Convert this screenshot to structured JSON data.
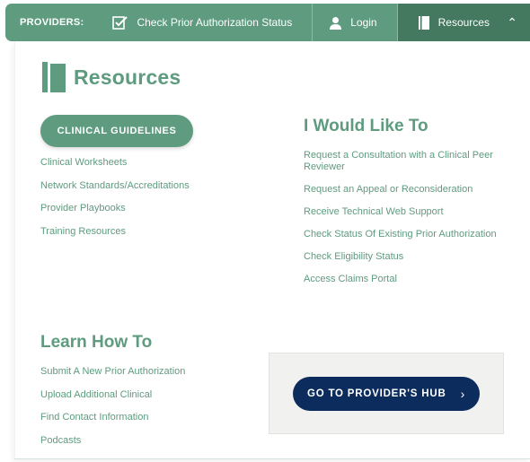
{
  "topbar": {
    "providers_label": "PROVIDERS:",
    "check_status_label": "Check Prior Authorization Status",
    "login_label": "Login",
    "resources_label": "Resources"
  },
  "menu": {
    "title": "Resources",
    "clinical_button": "CLINICAL GUIDELINES",
    "resources_links": [
      "Clinical Worksheets",
      "Network Standards/Accreditations",
      "Provider Playbooks",
      "Training Resources"
    ],
    "would_like_title": "I Would Like To",
    "would_like_links": [
      "Request a Consultation with a Clinical Peer Reviewer",
      "Request an Appeal or Reconsideration",
      "Receive Technical Web Support",
      "Check Status Of Existing Prior Authorization",
      "Check Eligibility Status",
      "Access Claims Portal"
    ],
    "learn_title": "Learn How To",
    "learn_links": [
      "Submit A New Prior Authorization",
      "Upload Additional Clinical",
      "Find Contact Information",
      "Podcasts"
    ],
    "hub_button": "GO TO PROVIDER'S HUB"
  },
  "colors": {
    "brand_green": "#5e9b7f",
    "active_green": "#44785f",
    "navy": "#0d2c5e"
  }
}
